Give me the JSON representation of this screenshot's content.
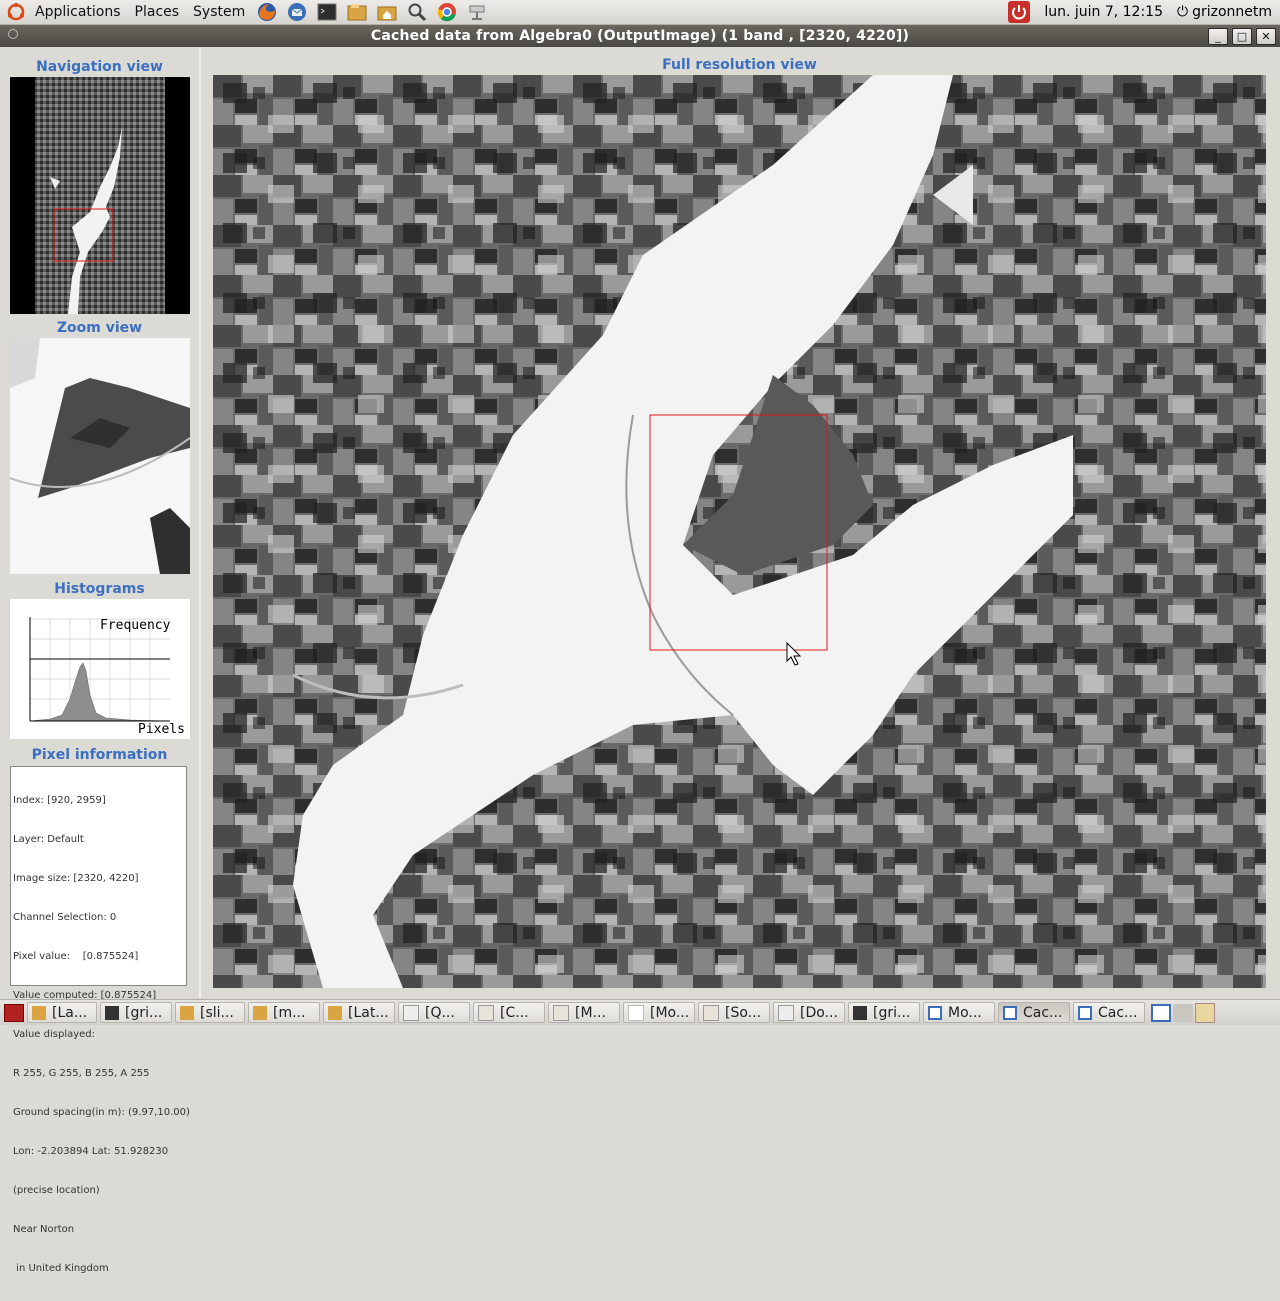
{
  "top_panel": {
    "menus": [
      "Applications",
      "Places",
      "System"
    ],
    "launchers": [
      "firefox-icon",
      "thunderbird-icon",
      "terminal-icon",
      "files-icon",
      "home-folder-icon",
      "search-icon",
      "chrome-icon",
      "network-icon"
    ],
    "clock": "lun. juin  7, 12:15",
    "user": "grizonnetm"
  },
  "window": {
    "title": "Cached data from Algebra0 (OutputImage) (1 band , [2320, 4220])"
  },
  "left_panel": {
    "navigation_title": "Navigation view",
    "zoom_title": "Zoom view",
    "histograms_title": "Histograms",
    "histogram_labels": {
      "y": "Frequency",
      "x": "Pixels"
    },
    "pixel_info_title": "Pixel information",
    "pixel_info": [
      "Index: [920, 2959]",
      "Layer: Default",
      "Image size: [2320, 4220]",
      "Channel Selection: 0",
      "Pixel value:    [0.875524]",
      "Value computed: [0.875524]",
      "Value displayed:",
      "R 255, G 255, B 255, A 255",
      "Ground spacing(in m): (9.97,10.00)",
      "Lon: -2.203894 Lat: 51.928230",
      "(precise location)",
      "Near Norton",
      " in United Kingdom"
    ]
  },
  "main": {
    "full_view_title": "Full resolution view"
  },
  "taskbar": {
    "items": [
      {
        "label": "[La...",
        "icon": "folder-icon"
      },
      {
        "label": "[gri...",
        "icon": "terminal-icon"
      },
      {
        "label": "[sli...",
        "icon": "folder-icon"
      },
      {
        "label": "[m...",
        "icon": "folder-icon"
      },
      {
        "label": "[Lat...",
        "icon": "folder-icon"
      },
      {
        "label": "[Q...",
        "icon": "document-icon"
      },
      {
        "label": "[C...",
        "icon": "editor-icon"
      },
      {
        "label": "[M...",
        "icon": "editor-icon"
      },
      {
        "label": "[Mo...",
        "icon": "blank-icon"
      },
      {
        "label": "[So...",
        "icon": "editor-icon"
      },
      {
        "label": "[Do...",
        "icon": "document-icon"
      },
      {
        "label": "[gri...",
        "icon": "terminal-icon"
      },
      {
        "label": "Mo...",
        "icon": "window-icon"
      },
      {
        "label": "Cac...",
        "icon": "window-icon"
      },
      {
        "label": "Cac...",
        "icon": "window-icon"
      }
    ]
  }
}
